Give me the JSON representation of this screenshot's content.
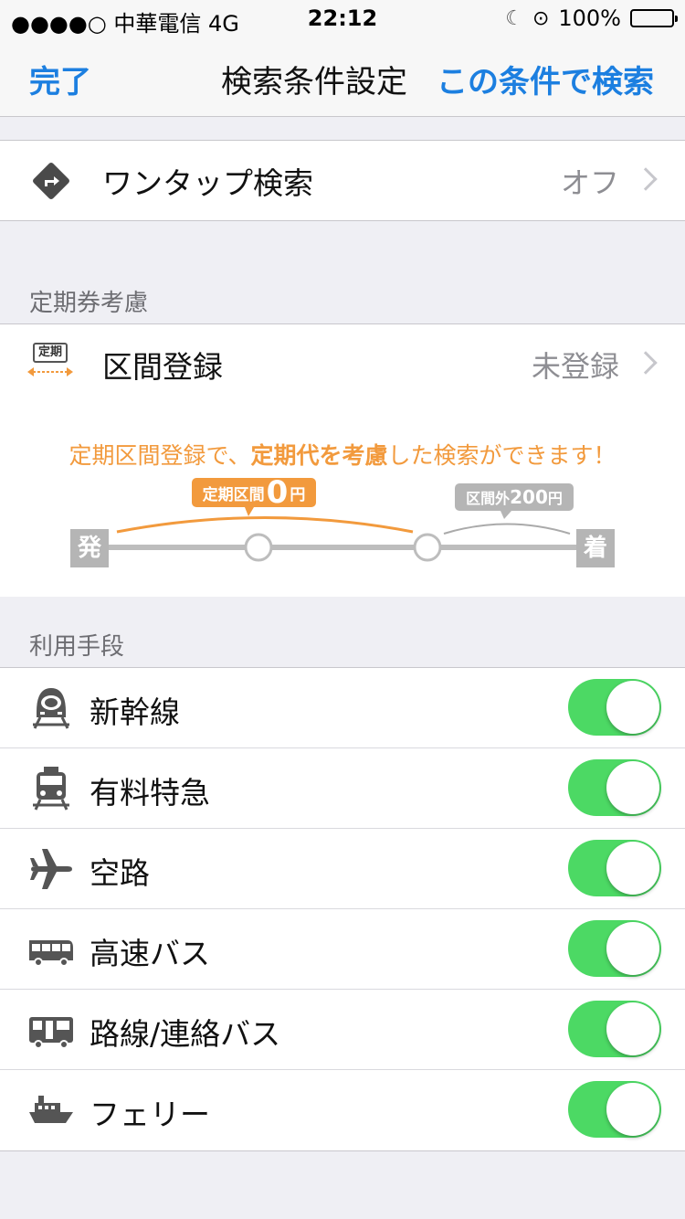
{
  "status_bar": {
    "carrier": "●●●●○ 中華電信 4G",
    "time": "22:12",
    "battery": "100%"
  },
  "nav": {
    "done": "完了",
    "title": "検索条件設定",
    "search": "この条件で検索"
  },
  "one_tap": {
    "label": "ワンタップ検索",
    "value": "オフ"
  },
  "pass_section": {
    "header": "定期券考慮",
    "label": "区間登録",
    "value": "未登録",
    "icon_text": "定期"
  },
  "banner": {
    "msg_prefix": "定期区間登録で、",
    "msg_bold": "定期代を考慮",
    "msg_suffix": "した検索ができます！",
    "pass_label": "定期区間",
    "pass_amount": "0",
    "pass_unit": "円",
    "outside_label": "区間外",
    "outside_amount": "200",
    "outside_unit": "円",
    "depart": "発",
    "arrive": "着"
  },
  "transport_section": {
    "header": "利用手段",
    "items": [
      {
        "label": "新幹線",
        "icon": "shinkansen-icon",
        "on": true
      },
      {
        "label": "有料特急",
        "icon": "express-train-icon",
        "on": true
      },
      {
        "label": "空路",
        "icon": "airplane-icon",
        "on": true
      },
      {
        "label": "高速バス",
        "icon": "highway-bus-icon",
        "on": true
      },
      {
        "label": "路線/連絡バス",
        "icon": "route-bus-icon",
        "on": true
      },
      {
        "label": "フェリー",
        "icon": "ferry-icon",
        "on": true
      }
    ]
  },
  "colors": {
    "accent": "#1c7fe0",
    "orange": "#f29a3d",
    "toggle_on": "#4cd964"
  }
}
